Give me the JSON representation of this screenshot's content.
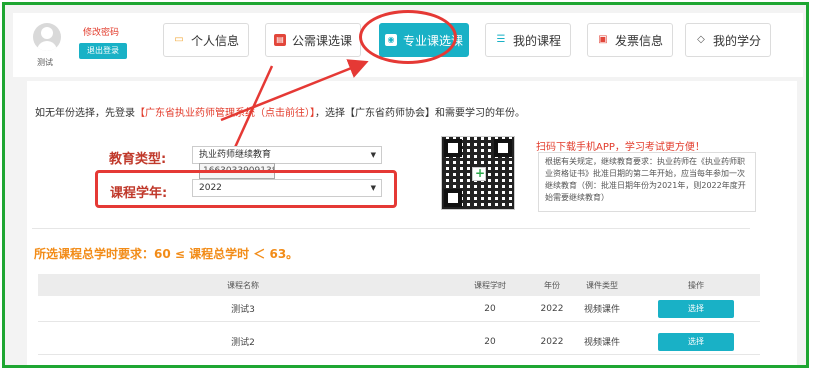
{
  "user": {
    "name": "测试",
    "change_password": "修改密码",
    "logout": "退出登录"
  },
  "tabs": [
    {
      "label": "个人信息",
      "icon": "folder-icon",
      "active": false
    },
    {
      "label": "公需课选课",
      "icon": "book-icon",
      "active": false
    },
    {
      "label": "专业课选课",
      "icon": "eye-icon",
      "active": true
    },
    {
      "label": "我的课程",
      "icon": "list-icon",
      "active": false
    },
    {
      "label": "发票信息",
      "icon": "invoice-icon",
      "active": false
    },
    {
      "label": "我的学分",
      "icon": "graduation-icon",
      "active": false
    }
  ],
  "intro": {
    "part1": "如无年份选择，先登录",
    "link": "【广东省执业药师管理系统（点击前往）】",
    "part2": "，选择【广东省药师协会】和需要学习的年份。"
  },
  "form": {
    "edu_type_label": "教育类型:",
    "edu_type_value": "执业药师继续教育",
    "year_label": "课程学年:",
    "year_value": "2022",
    "tooltip": "1663033909138242.png"
  },
  "qr": {
    "scan_text": "扫码下载手机APP，学习考试更方便！",
    "notice": "根据有关规定，继续教育要求：执业药师在《执业药师职业资格证书》批准日期的第二年开始，应当每年参加一次继续教育（例：批准日期年份为2021年，则2022年度开始需要继续教育）"
  },
  "requirement": "所选课程总学时要求：60 ≤ 课程总学时 ＜ 63。",
  "table": {
    "headers": [
      "课程名称",
      "课程学时",
      "年份",
      "课件类型",
      "操作"
    ],
    "rows": [
      {
        "name": "测试3",
        "hours": "20",
        "year": "2022",
        "type": "视频课件",
        "action": "选择"
      },
      {
        "name": "测试2",
        "hours": "20",
        "year": "2022",
        "type": "视频课件",
        "action": "选择"
      }
    ]
  },
  "colors": {
    "accent": "#19b1c6",
    "highlight": "#e53935",
    "warning": "#f28c18",
    "frame": "#1ea632"
  }
}
